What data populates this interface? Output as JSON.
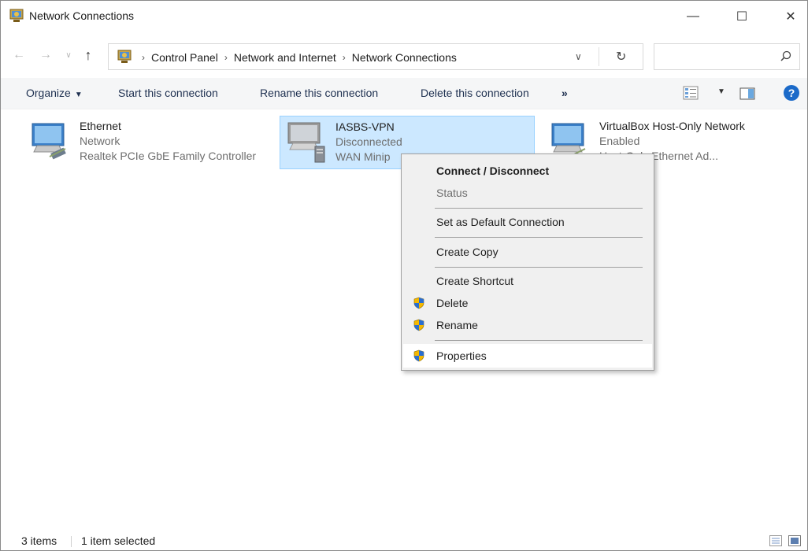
{
  "window": {
    "title": "Network Connections",
    "icon": "network-connections-icon",
    "controls": {
      "minimize": "—",
      "maximize": "☐",
      "close": "✕"
    }
  },
  "address": {
    "breadcrumbs": [
      "Control Panel",
      "Network and Internet",
      "Network Connections"
    ],
    "separator": "›",
    "search_placeholder": ""
  },
  "commandbar": {
    "organize": "Organize",
    "start": "Start this connection",
    "rename": "Rename this connection",
    "delete": "Delete this connection",
    "more": "»",
    "help": "?"
  },
  "connections": [
    {
      "name": "Ethernet",
      "status": "Network",
      "device": "Realtek PCIe GbE Family Controller",
      "icon": "ethernet-adapter-icon",
      "selected": false
    },
    {
      "name": "IASBS-VPN",
      "status": "Disconnected",
      "device": "WAN Minip",
      "icon": "vpn-adapter-icon",
      "selected": true
    },
    {
      "name": "VirtualBox Host-Only Network",
      "status": "Enabled",
      "device": "Host-Only Ethernet Ad...",
      "icon": "virtualbox-adapter-icon",
      "selected": false
    }
  ],
  "context_menu": {
    "connect": "Connect / Disconnect",
    "status": "Status",
    "set_default": "Set as Default Connection",
    "create_copy": "Create Copy",
    "create_shortcut": "Create Shortcut",
    "delete": "Delete",
    "rename": "Rename",
    "properties": "Properties",
    "shield_icon": "uac-shield-icon"
  },
  "statusbar": {
    "count": "3 items",
    "selection": "1 item selected"
  },
  "colors": {
    "selection_bg": "#cce8ff",
    "selection_border": "#99d1ff",
    "menu_bg": "#f0f0f0",
    "help_blue": "#1b6ac9"
  }
}
